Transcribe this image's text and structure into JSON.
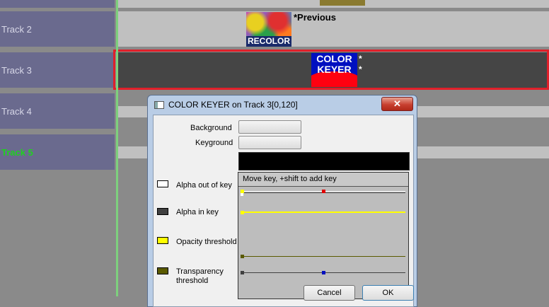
{
  "tracks": [
    {
      "label": "Track 2"
    },
    {
      "label": "Track 3"
    },
    {
      "label": "Track 4"
    },
    {
      "label": "Track 5"
    }
  ],
  "clips": {
    "recolor": {
      "thumb_text": "RECOLOR",
      "caption": "*Previous"
    },
    "color_keyer": {
      "thumb_line1": "COLOR",
      "thumb_line2": "KEYER",
      "mark1": "*",
      "mark2": "*"
    }
  },
  "dialog": {
    "title": "COLOR KEYER  on  Track 3[0,120]",
    "close_glyph": "✕",
    "background_label": "Background",
    "keyground_label": "Keyground",
    "legend": {
      "alpha_out": "Alpha out of key",
      "alpha_in": "Alpha in key",
      "opacity": "Opacity threshold",
      "transparency_line1": "Transparency",
      "transparency_line2": "threshold"
    },
    "graph_header": "Move key,  +shift to add key",
    "cancel_label": "Cancel",
    "ok_label": "OK"
  },
  "colors": {
    "alpha_out": "#ffffff",
    "alpha_in": "#404040",
    "opacity": "#ffff00",
    "transparency": "#5a5a00",
    "selection": "#e0202a",
    "active_track_label": "#20d020",
    "key_red": "#e00000",
    "key_blue": "#0010c0"
  },
  "icons": {
    "dialog_icon": "window-icon",
    "close": "close-icon"
  }
}
